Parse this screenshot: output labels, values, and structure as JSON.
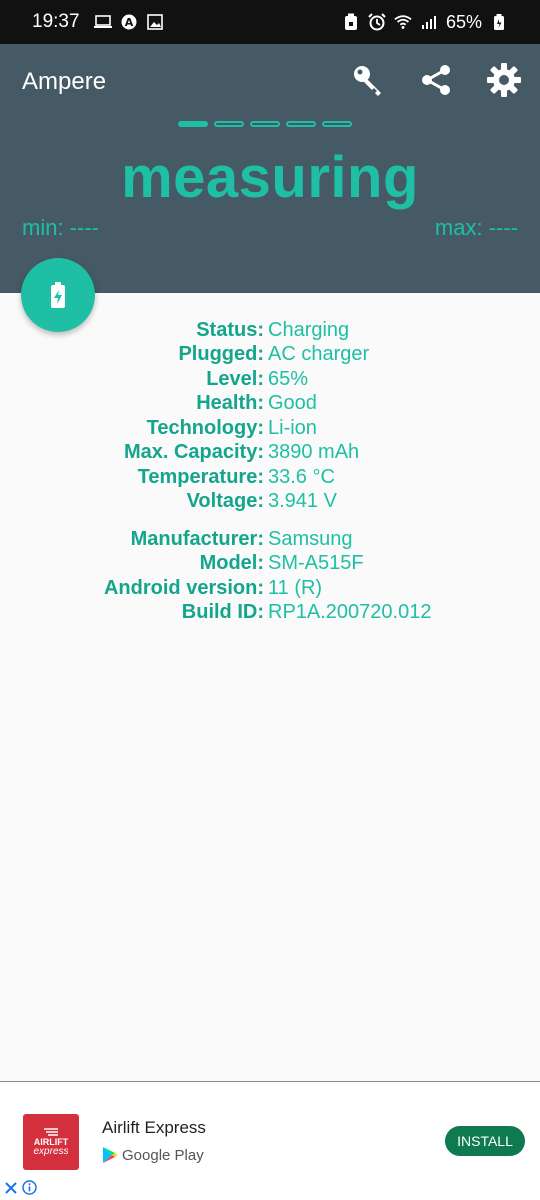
{
  "status_bar": {
    "time": "19:37",
    "battery": "65%"
  },
  "app": {
    "title": "Ampere",
    "toolbar_icons": [
      "key-icon",
      "share-icon",
      "settings-icon"
    ]
  },
  "pager": {
    "count": 5,
    "active": 0
  },
  "measurement": {
    "state": "measuring",
    "min": "min: ----",
    "max": "max: ----"
  },
  "battery_info": [
    {
      "label": "Status:",
      "value": "Charging"
    },
    {
      "label": "Plugged:",
      "value": "AC charger"
    },
    {
      "label": "Level:",
      "value": "65%"
    },
    {
      "label": "Health:",
      "value": "Good"
    },
    {
      "label": "Technology:",
      "value": "Li-ion"
    },
    {
      "label": "Max. Capacity:",
      "value": "3890 mAh"
    },
    {
      "label": "Temperature:",
      "value": "33.6 °C"
    },
    {
      "label": "Voltage:",
      "value": "3.941 V"
    }
  ],
  "device_info": [
    {
      "label": "Manufacturer:",
      "value": "Samsung"
    },
    {
      "label": "Model:",
      "value": "SM-A515F"
    },
    {
      "label": "Android version:",
      "value": "11 (R)"
    },
    {
      "label": "Build ID:",
      "value": "RP1A.200720.012"
    }
  ],
  "ad": {
    "logo_text": "AIRLIFT",
    "logo_sub": "express",
    "title": "Airlift Express",
    "store": "Google Play",
    "install_label": "INSTALL"
  },
  "colors": {
    "accent": "#1ebfa5",
    "header": "#455a64",
    "install": "#0f7a4f",
    "ad_logo": "#d32f3c"
  }
}
